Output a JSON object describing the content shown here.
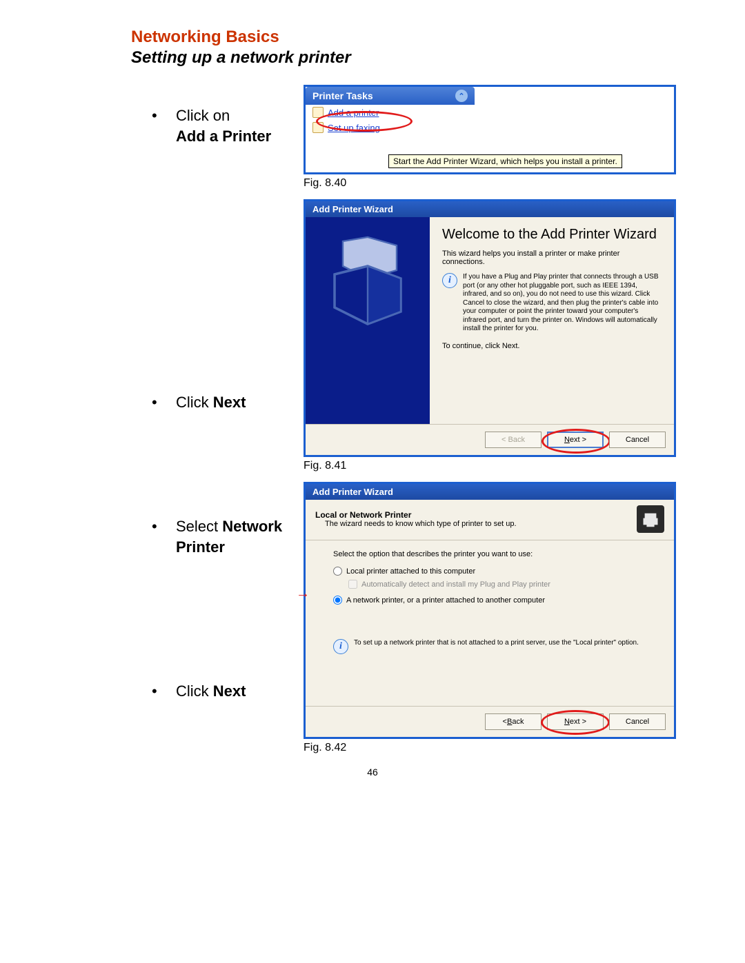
{
  "page_number": "46",
  "heading": {
    "primary": "Networking Basics",
    "sub": "Setting up a network printer"
  },
  "captions": {
    "fig1": "Fig. 8.40",
    "fig2": "Fig. 8.41",
    "fig3": "Fig. 8.42"
  },
  "instructions": {
    "step1_a": "Click on",
    "step1_b": "Add a Printer",
    "step2_a": "Click ",
    "step2_b": "Next",
    "step3_a": "Select ",
    "step3_b": "Network Printer",
    "step4_a": "Click ",
    "step4_b": "Next"
  },
  "printer_tasks": {
    "header": "Printer Tasks",
    "link_add": "Add a printer",
    "link_faxing": "Set up faxing",
    "tooltip": "Start the Add Printer Wizard, which helps you install a printer."
  },
  "wizard1": {
    "title": "Add Printer Wizard",
    "welcome": "Welcome to the Add Printer Wizard",
    "desc": "This wizard helps you install a printer or make printer connections.",
    "info": "If you have a Plug and Play printer that connects through a USB port (or any other hot pluggable port, such as IEEE 1394, infrared, and so on), you do not need to use this wizard. Click Cancel to close the wizard, and then plug the printer's cable into your computer or point the printer toward your computer's infrared port, and turn the printer on. Windows will automatically install the printer for you.",
    "continue": "To continue, click Next.",
    "back": "< Back",
    "next_pre": "N",
    "next_post": "ext >",
    "cancel": "Cancel"
  },
  "wizard2": {
    "title": "Add Printer Wizard",
    "hdr_t1": "Local or Network Printer",
    "hdr_t2": "The wizard needs to know which type of printer to set up.",
    "lead": "Select the option that describes the printer you want to use:",
    "opt_local_pre": "L",
    "opt_local_post": "ocal printer attached to this computer",
    "opt_auto_pre": "A",
    "opt_auto_post": "utomatically detect and install my Plug and Play printer",
    "opt_net_pre1": "A n",
    "opt_net_u": "e",
    "opt_net_post": "twork printer, or a printer attached to another computer",
    "info": "To set up a network printer that is not attached to a print server, use the \"Local printer\" option.",
    "back_pre": "< ",
    "back_u": "B",
    "back_post": "ack",
    "next_pre": "N",
    "next_post": "ext >",
    "cancel": "Cancel"
  }
}
